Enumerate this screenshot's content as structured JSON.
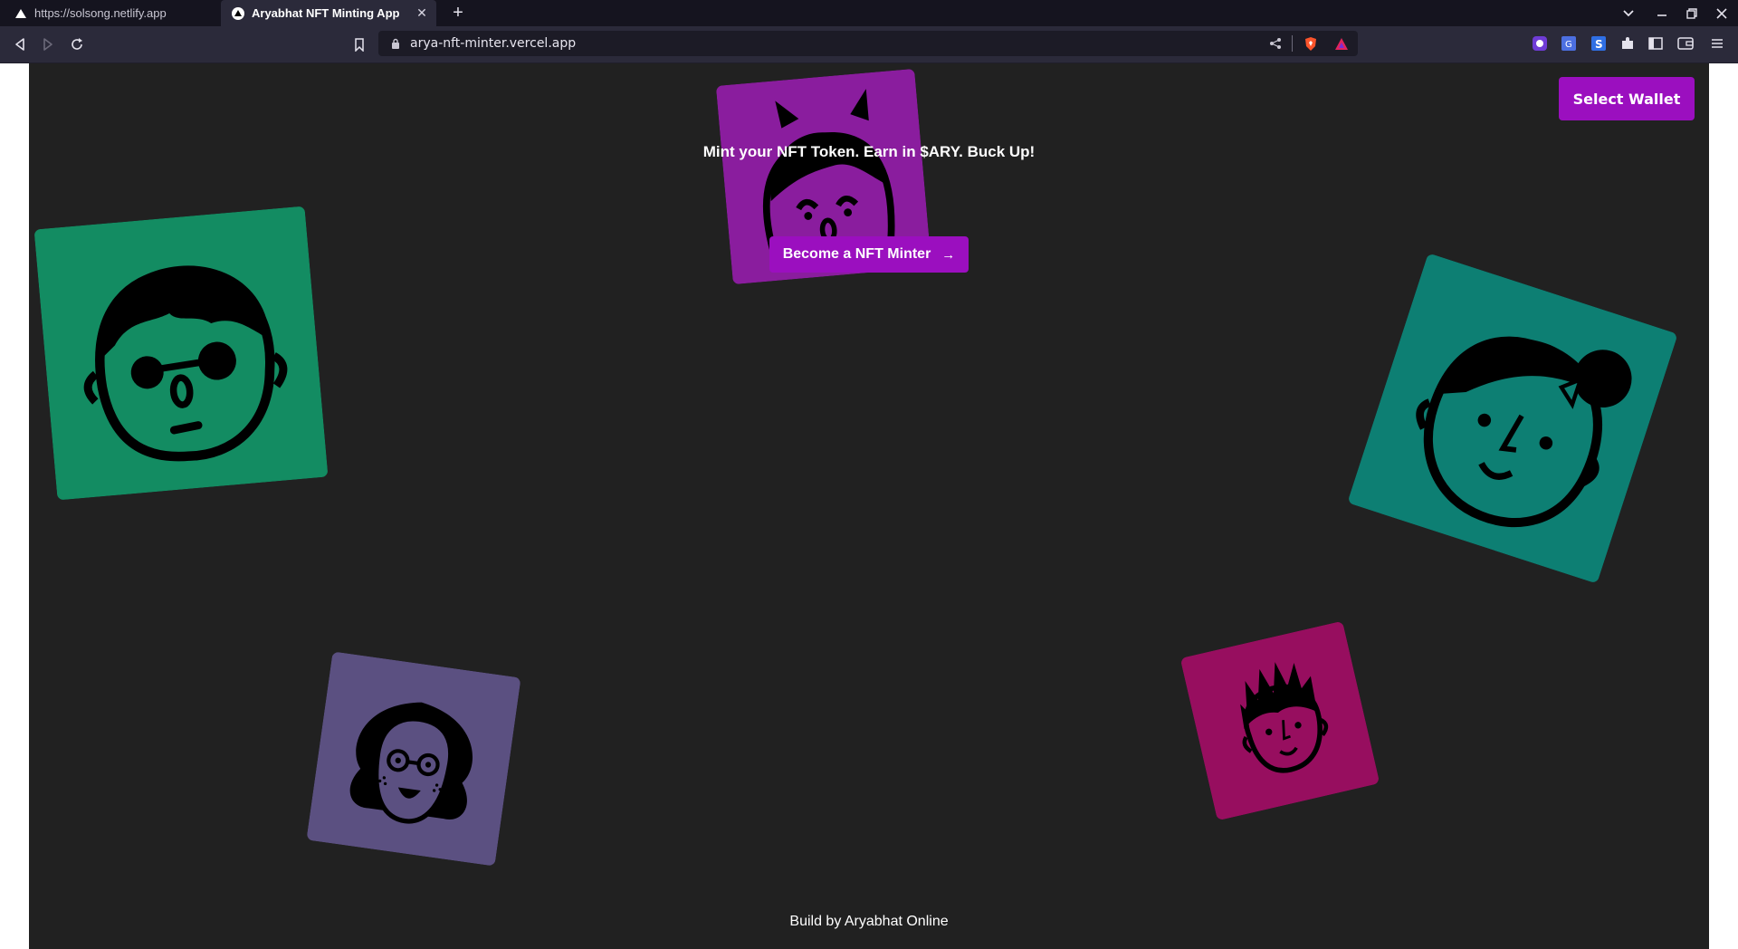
{
  "browser": {
    "tabs": [
      {
        "title": "https://solsong.netlify.app",
        "active": false
      },
      {
        "title": "Aryabhat NFT Minting App",
        "active": true
      }
    ],
    "url": "arya-nft-minter.vercel.app"
  },
  "page": {
    "wallet_button": "Select Wallet",
    "headline": "Mint your NFT Token. Earn in $ARY. Buck Up!",
    "mint_button": "Become a NFT Minter",
    "footer": "Build by Aryabhat Online"
  },
  "avatars": [
    {
      "name": "devil-avatar",
      "color": "#8a1d9e"
    },
    {
      "name": "sunglasses-avatar",
      "color": "#138c62"
    },
    {
      "name": "bow-girl-avatar",
      "color": "#0d7f73"
    },
    {
      "name": "glasses-girl-avatar",
      "color": "#5b5081"
    },
    {
      "name": "spiky-hair-avatar",
      "color": "#970e5f"
    }
  ],
  "colors": {
    "page_background": "#212121",
    "accent": "#9b0fbf"
  }
}
